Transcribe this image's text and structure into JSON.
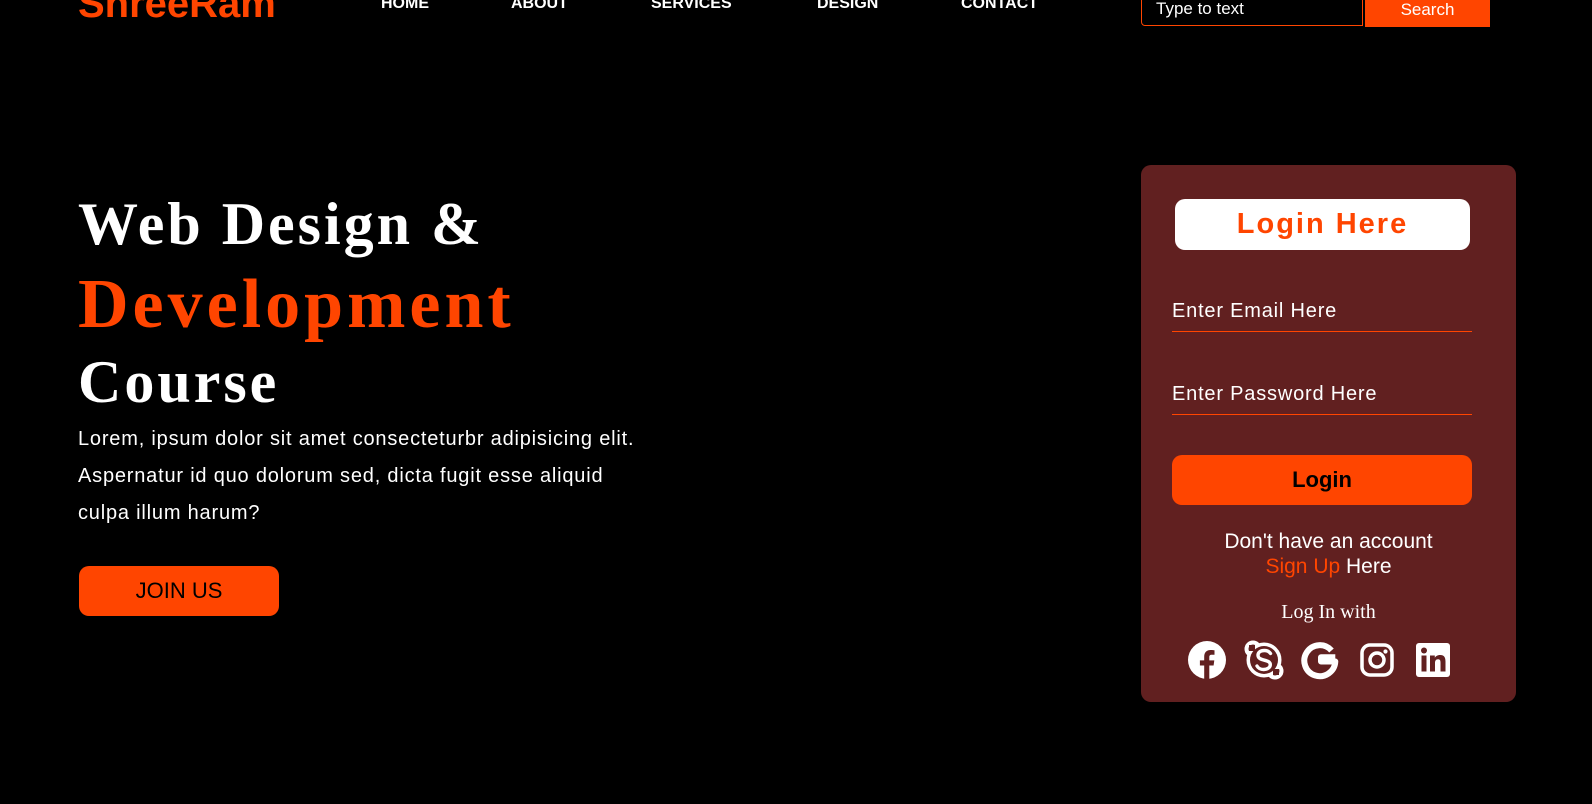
{
  "header": {
    "logo": "ShreeRam",
    "nav": [
      "HOME",
      "ABOUT",
      "SERVICES",
      "DESIGN",
      "CONTACT"
    ],
    "search_placeholder": "Type to text",
    "search_button": "Search"
  },
  "hero": {
    "line1": "Web Design &",
    "line2": "Development",
    "line3": "Course",
    "paragraph": "Lorem, ipsum dolor sit amet consecteturbr adipisicing elit. Aspernatur id quo dolorum sed, dicta fugit esse aliquid culpa illum harum?",
    "join_button": "JOIN US"
  },
  "login": {
    "heading": "Login Here",
    "email_placeholder": "Enter Email Here",
    "password_placeholder": "Enter Password Here",
    "login_button": "Login",
    "no_account": "Don't have an account",
    "signup_link": "Sign Up",
    "signup_suffix": " Here",
    "login_with": "Log In with",
    "social_icons": [
      "facebook-icon",
      "skype-icon",
      "google-icon",
      "instagram-icon",
      "linkedin-icon"
    ]
  },
  "colors": {
    "accent": "#ff4500",
    "card_background": "#612020",
    "page_background": "#000000",
    "text": "#ffffff"
  }
}
